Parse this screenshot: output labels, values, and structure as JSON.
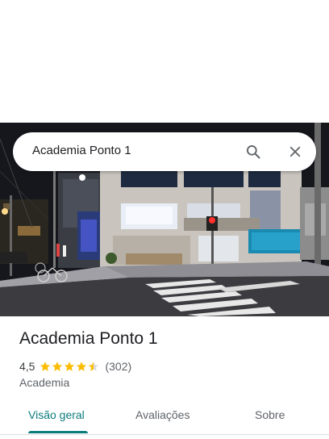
{
  "search": {
    "query": "Academia Ponto 1",
    "search_icon": "search-icon",
    "close_icon": "close-icon"
  },
  "place": {
    "name": "Academia Ponto 1",
    "rating": "4,5",
    "rating_stars": 4.5,
    "review_count": "(302)",
    "category": "Academia"
  },
  "tabs": [
    {
      "label": "Visão geral",
      "active": true
    },
    {
      "label": "Avaliações",
      "active": false
    },
    {
      "label": "Sobre",
      "active": false
    }
  ],
  "colors": {
    "accent": "#0b7c7c",
    "star": "#fbbc04",
    "text_primary": "#202124",
    "text_secondary": "#5f6368"
  }
}
